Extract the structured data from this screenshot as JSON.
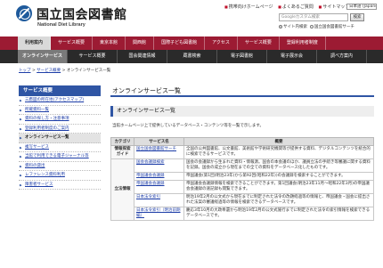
{
  "header": {
    "title": "国立国会図書館",
    "subtitle": "National Diet Library",
    "util_links": [
      "携帯向けホームページ",
      "よくあるご質問",
      "サイトマップ"
    ],
    "language": "日本語 (Japanese)",
    "search_placeholder": "Googleカスタム検索",
    "search_button": "検索",
    "scope_site": "サイト内検索",
    "scope_ndl": "国立国会図書館サーチ"
  },
  "main_nav": [
    "利用案内",
    "サービス概要",
    "東京本館",
    "関西館",
    "国際子ども図書館",
    "アクセス",
    "サービス概要",
    "登録利用者制度"
  ],
  "sub_nav": [
    "オンラインサービス",
    "サービス概要",
    "国会関連情報",
    "蔵書検索",
    "電子図書館",
    "電子展示会",
    "調べ方案内",
    "電子展示会"
  ],
  "breadcrumb": {
    "items": [
      "トップ",
      "サービス概要"
    ],
    "current": "オンラインサービス一覧"
  },
  "sidebar": {
    "header": "サービス概要",
    "items": [
      "三鷹図の所在地(アクセスマップ)",
      "所蔵資料一覧",
      "資料の探し方・注意事項",
      "登録利用者制度のご案内",
      "オンラインサービス一覧",
      "複写サービス",
      "当館で利用できる電子ジャーナル等",
      "資料の貸出",
      "レファレンス資料利用",
      "障害者サービス"
    ]
  },
  "content": {
    "page_title": "オンラインサービス一覧",
    "section_title": "オンラインサービス一覧",
    "intro": "当館ホームページ上で提供しているデータベース・コンテンツ等を一覧で示します。",
    "table": {
      "headers": [
        "カテゴリ",
        "サービス名",
        "概要"
      ],
      "rows": [
        {
          "service": "国立国会図書館サーチ",
          "desc": "全国の公共図書館、公文書館、美術館や学術研究機関等が提供する資料、デジタルコンテンツを統合的に検索できるサービスです。"
        },
        {
          "service": "国会会議録検索",
          "desc": "国会の会議録から生まれた資料・情報源。国会の本会議のほか、議員立法の手続き等審議に関する資料を記録。国会の成立から現在までの全ての資料をデータベース化したものです。"
        },
        {
          "service": "帝国議会会議録",
          "desc": "帝国議会(第1回(明治23年)から第92回(昭和22年))の会議録を検索することができます。"
        },
        {
          "service": "帝国議会会議録",
          "desc": "帝国議会会議録情報を検索できることができます。第1回議会(明治23年11月～昭和22年3月)の帝国議会会議録の速記録も閲覧できます。"
        },
        {
          "service": "日本法令索引",
          "desc": "明治19年2月の公文式から現在までに制定された法令の改題経過等の情報と、帝国議会・国会に提出された法案の審議経過等の情報を検索できるデータベースです。"
        },
        {
          "service": "日本法令索引〔明治前期編〕",
          "desc": "慶応3年10月の大政奉還から明治19年2月の公文式施行までに制定された法令の索引情報を検索できるデータベースです。"
        }
      ]
    },
    "category_1": "情報探索ガイド",
    "category_2": "立法情報"
  },
  "colors": {
    "main_nav": "#9c1b33",
    "sub_nav": "#2a2a2a",
    "accent_blue": "#2f55a4",
    "link": "#1f3fa8"
  }
}
